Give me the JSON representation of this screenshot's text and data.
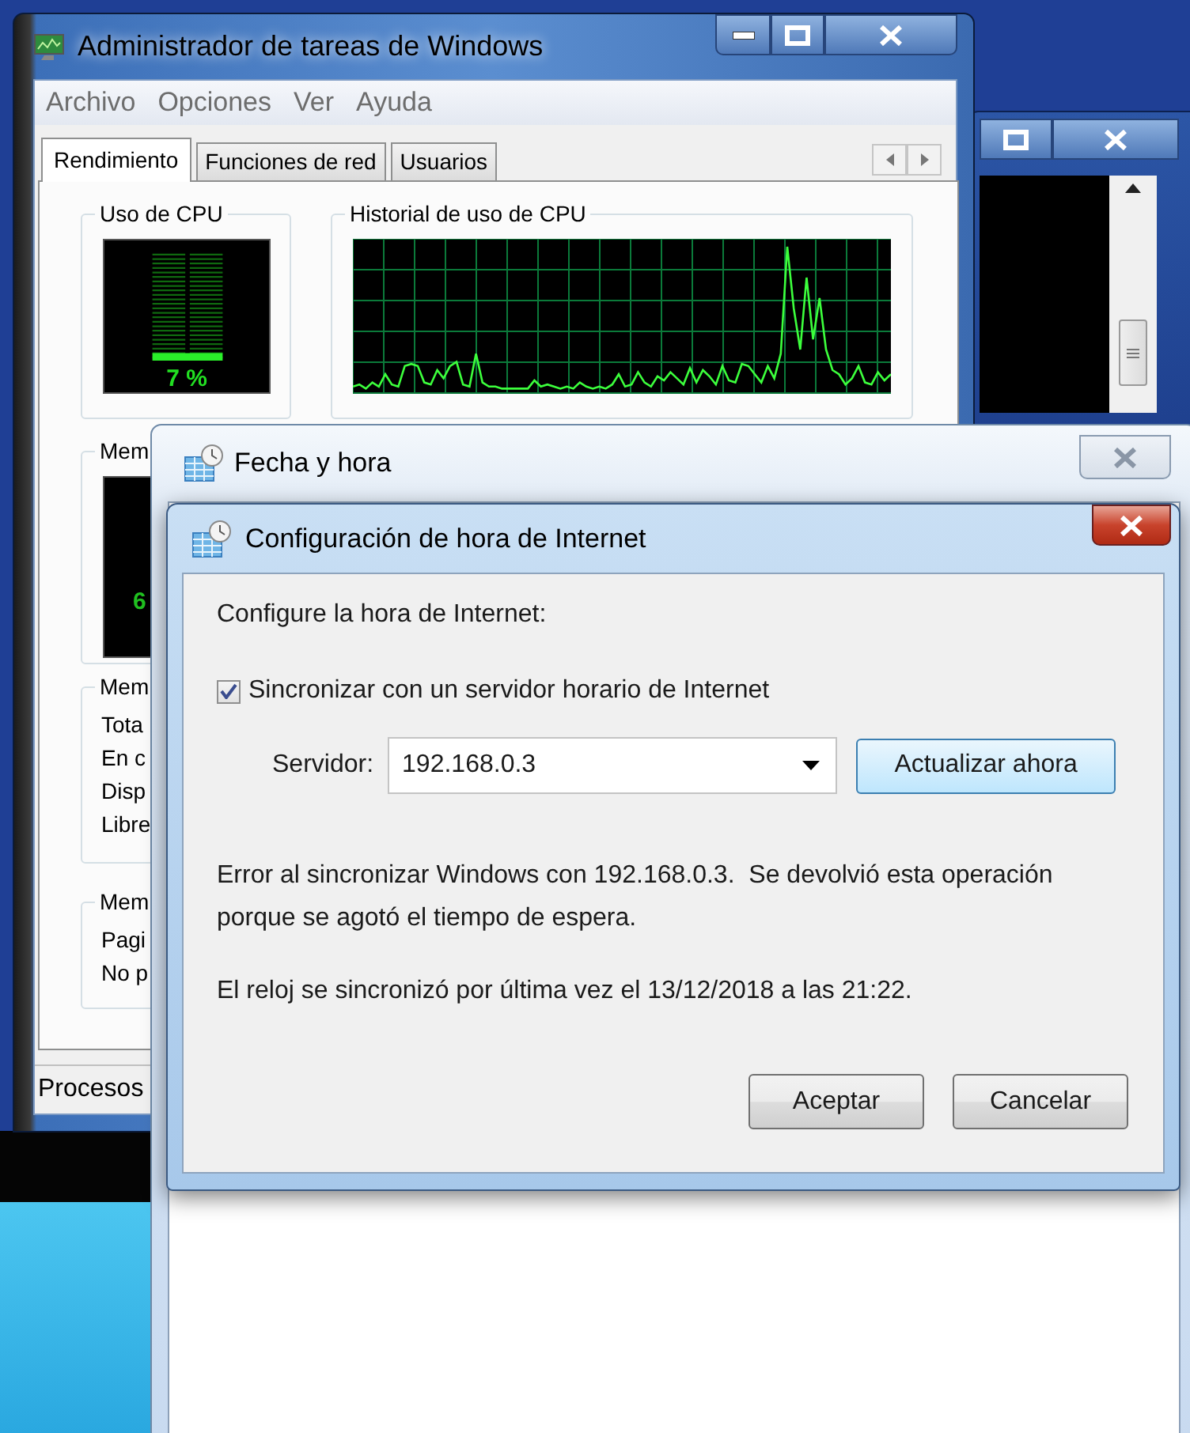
{
  "task_manager": {
    "title": "Administrador de tareas de Windows",
    "menu": [
      "Archivo",
      "Opciones",
      "Ver",
      "Ayuda"
    ],
    "tabs": [
      {
        "label": "Rendimiento",
        "selected": true
      },
      {
        "label": "Funciones de red",
        "selected": false
      },
      {
        "label": "Usuarios",
        "selected": false
      }
    ],
    "cpu_usage": {
      "title": "Uso de CPU",
      "reading": "7 %",
      "level": 0.07
    },
    "cpu_history": {
      "title": "Historial de uso de CPU"
    },
    "memory": {
      "title": "Mem",
      "reading": "6"
    },
    "physical_memory": {
      "title": "Mem",
      "rows": [
        "Tota",
        "En c",
        "Disp",
        "Libre"
      ]
    },
    "kernel_memory": {
      "title": "Mem",
      "rows": [
        "Pagi",
        "No p"
      ]
    },
    "status_bar": "Procesos"
  },
  "date_time_window": {
    "title": "Fecha y hora"
  },
  "dialog": {
    "title": "Configuración de hora de Internet",
    "heading": "Configure la hora de Internet:",
    "sync": {
      "label": "Sincronizar con un servidor horario de Internet",
      "checked": true
    },
    "server": {
      "label": "Servidor:",
      "value": "192.168.0.3"
    },
    "update_button": "Actualizar ahora",
    "error": "Error al sincronizar Windows con 192.168.0.3.  Se devolvió esta operación porque se agotó el tiempo de espera.",
    "last_sync": "El reloj se sincronizó por última vez el 13/12/2018 a las 21:22.",
    "buttons": [
      "Aceptar",
      "Cancelar"
    ]
  }
}
